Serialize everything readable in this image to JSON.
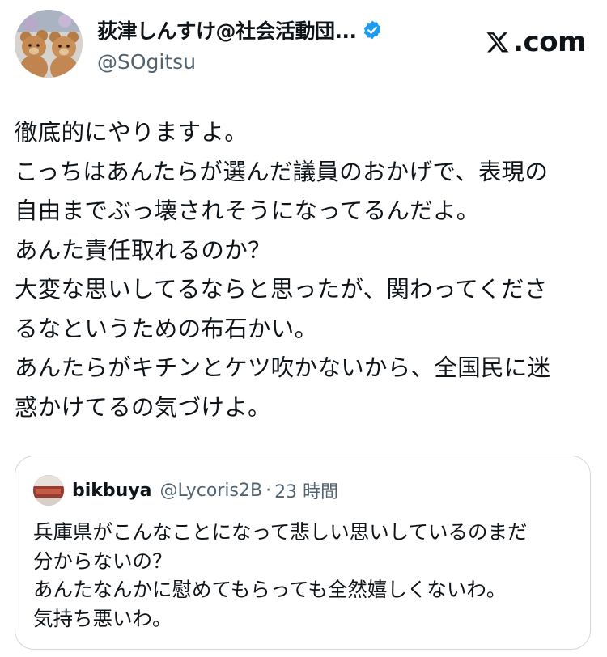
{
  "tweet": {
    "author": {
      "display_name": "荻津しんすけ@社会活動団...",
      "handle": "@SOgitsu",
      "verified_icon": "verified-badge-icon",
      "avatar_icon": "teddy-bears-avatar"
    },
    "site_label": ".com",
    "site_icon": "x-logo-icon",
    "lines": [
      "徹底的にやりますよ。",
      "こっちはあんたらが選んだ議員のおかげで、表現の",
      "自由までぶっ壊されそうになってるんだよ。",
      "あんた責任取れるのか？",
      "大変な思いしてるならと思ったが、関わってくださ",
      "るなというための布石かい。",
      "あんたらがキチンとケツ吹かないから、全国民に迷",
      "惑かけてるの気づけよ。"
    ]
  },
  "quote": {
    "author": {
      "display_name": "bikbuya",
      "handle": "@Lycoris2B",
      "separator": "·",
      "time": "23 時間"
    },
    "lines": [
      "兵庫県がこんなことになって悲しい思いしているのまだ",
      "分からないの？",
      "あんたなんかに慰めてもらっても全然嬉しくないわ。",
      "気持ち悪いわ。"
    ]
  },
  "colors": {
    "text_primary": "#0f1419",
    "text_secondary": "#536471",
    "verified_blue": "#1d9bf0",
    "border": "#cfd9de"
  }
}
